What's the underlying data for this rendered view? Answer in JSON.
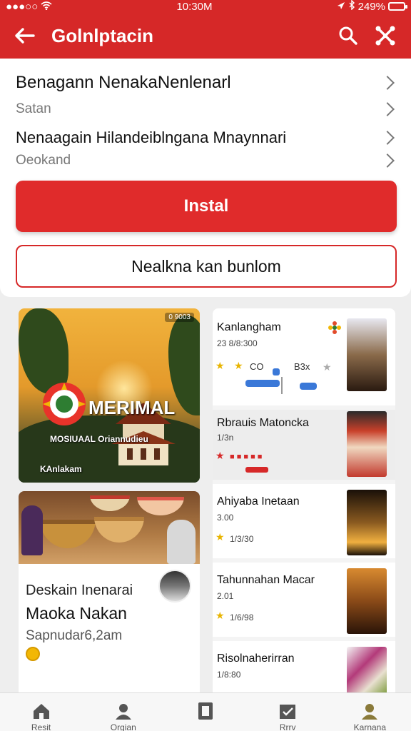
{
  "status": {
    "time": "10:30M",
    "battery": "249%",
    "carrier": "●●●○○"
  },
  "appbar": {
    "title": "Golnlptacin"
  },
  "rows": [
    {
      "title": "Benagann NenakaNenlenarl",
      "sub": "Satan"
    },
    {
      "title": "Nenaagain Hilandeiblngana Mnaynnari",
      "sub": "Oeokand"
    }
  ],
  "buttons": {
    "install": "Instal",
    "secondary": "Nealkna kan bunlom"
  },
  "hero": {
    "logo_text": "MERIMAL",
    "line1": "MOSIUAAL Oriannudieu",
    "line2": "KAnlakam",
    "badge": "0 9003"
  },
  "food": {
    "title1": "Deskain Inenarai",
    "title2": "Maoka Nakan",
    "title3": "Sapnudar6,2am"
  },
  "list": [
    {
      "name": "Kanlangham",
      "meta": "23 8/8:300",
      "stars": "★",
      "chip1": "CO",
      "chip2": "B3x",
      "thumb": "#3c2a1c"
    },
    {
      "name": "Rbrauis Matoncka",
      "meta": "1/3n",
      "stars": "★",
      "chip1": "",
      "chip2": "",
      "thumb": "#6b4a36"
    },
    {
      "name": "Ahiyaba Inetaan",
      "meta": "3.00",
      "stars": "★",
      "chip1": "",
      "chip2": "1/3/30",
      "thumb": "#1d1410"
    },
    {
      "name": "Tahunnahan Macar",
      "meta": "2.01",
      "stars": "★",
      "chip1": "",
      "chip2": "1/6/98",
      "thumb": "#2a1a10"
    },
    {
      "name": "Risolnaherirran",
      "meta": "1/8:80",
      "stars": "",
      "chip1": "",
      "chip2": "",
      "thumb": "#b33a7a"
    }
  ],
  "nav": [
    {
      "label": "Resit",
      "icon": "home-icon"
    },
    {
      "label": "Orgian",
      "icon": "person-icon"
    },
    {
      "label": "",
      "icon": "tablet-icon"
    },
    {
      "label": "Rrrv",
      "icon": "calendar-check-icon"
    },
    {
      "label": "Karnana",
      "icon": "profile-icon"
    }
  ],
  "colors": {
    "brand": "#d62828",
    "accent_star": "#e8b400"
  }
}
